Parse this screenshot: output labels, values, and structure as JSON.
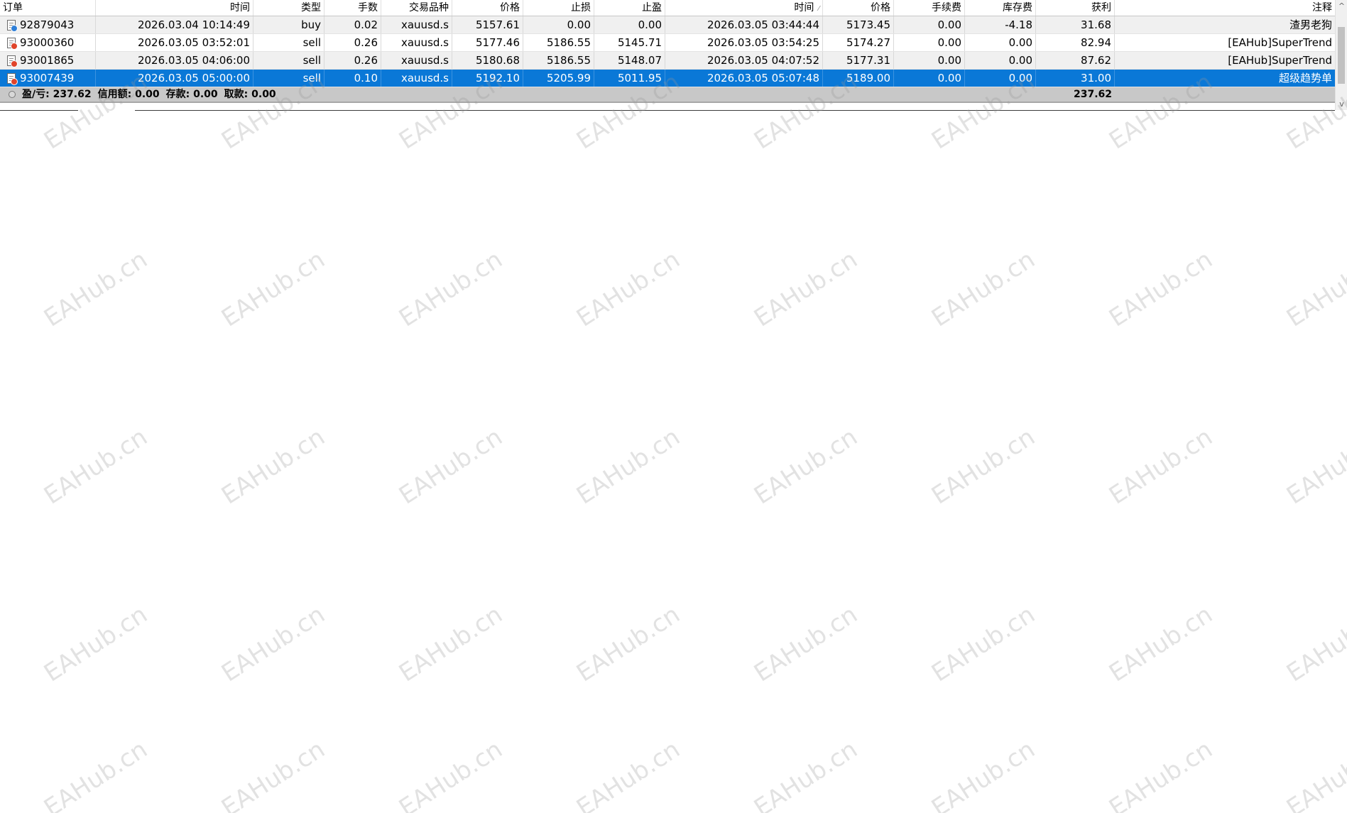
{
  "columns": [
    {
      "key": "order",
      "label": "订单"
    },
    {
      "key": "open_time",
      "label": "时间"
    },
    {
      "key": "type",
      "label": "类型"
    },
    {
      "key": "lots",
      "label": "手数"
    },
    {
      "key": "symbol",
      "label": "交易品种"
    },
    {
      "key": "open_price",
      "label": "价格"
    },
    {
      "key": "sl",
      "label": "止损"
    },
    {
      "key": "tp",
      "label": "止盈"
    },
    {
      "key": "close_time",
      "label": "时间",
      "sort": "⁄"
    },
    {
      "key": "close_price",
      "label": "价格"
    },
    {
      "key": "commission",
      "label": "手续费"
    },
    {
      "key": "swap",
      "label": "库存费"
    },
    {
      "key": "profit",
      "label": "获利"
    },
    {
      "key": "comment",
      "label": "注释"
    }
  ],
  "rows": [
    {
      "order": "92879043",
      "open_time": "2026.03.04 10:14:49",
      "type": "buy",
      "lots": "0.02",
      "symbol": "xauusd.s",
      "open_price": "5157.61",
      "sl": "0.00",
      "tp": "0.00",
      "close_time": "2026.03.05 03:44:44",
      "close_price": "5173.45",
      "commission": "0.00",
      "swap": "-4.18",
      "profit": "31.68",
      "comment": "渣男老狗",
      "icon_color": "#2f7fd8"
    },
    {
      "order": "93000360",
      "open_time": "2026.03.05 03:52:01",
      "type": "sell",
      "lots": "0.26",
      "symbol": "xauusd.s",
      "open_price": "5177.46",
      "sl": "5186.55",
      "tp": "5145.71",
      "close_time": "2026.03.05 03:54:25",
      "close_price": "5174.27",
      "commission": "0.00",
      "swap": "0.00",
      "profit": "82.94",
      "comment": "[EAHub]SuperTrend",
      "icon_color": "#e0442a"
    },
    {
      "order": "93001865",
      "open_time": "2026.03.05 04:06:00",
      "type": "sell",
      "lots": "0.26",
      "symbol": "xauusd.s",
      "open_price": "5180.68",
      "sl": "5186.55",
      "tp": "5148.07",
      "close_time": "2026.03.05 04:07:52",
      "close_price": "5177.31",
      "commission": "0.00",
      "swap": "0.00",
      "profit": "87.62",
      "comment": "[EAHub]SuperTrend",
      "icon_color": "#e0442a"
    },
    {
      "order": "93007439",
      "open_time": "2026.03.05 05:00:00",
      "type": "sell",
      "lots": "0.10",
      "symbol": "xauusd.s",
      "open_price": "5192.10",
      "sl": "5205.99",
      "tp": "5011.95",
      "close_time": "2026.03.05 05:07:48",
      "close_price": "5189.00",
      "commission": "0.00",
      "swap": "0.00",
      "profit": "31.00",
      "comment": "超级趋势单",
      "icon_color": "#e0442a",
      "selected": true
    }
  ],
  "summary": {
    "pnl_label": "盈/亏: 237.62",
    "credit_label": "信用额: 0.00",
    "deposit_label": "存款: 0.00",
    "withdrawal_label": "取款: 0.00",
    "total_profit": "237.62"
  },
  "scrollbar": {
    "up": "^",
    "down": "v"
  },
  "watermark": "EAHub.cn"
}
